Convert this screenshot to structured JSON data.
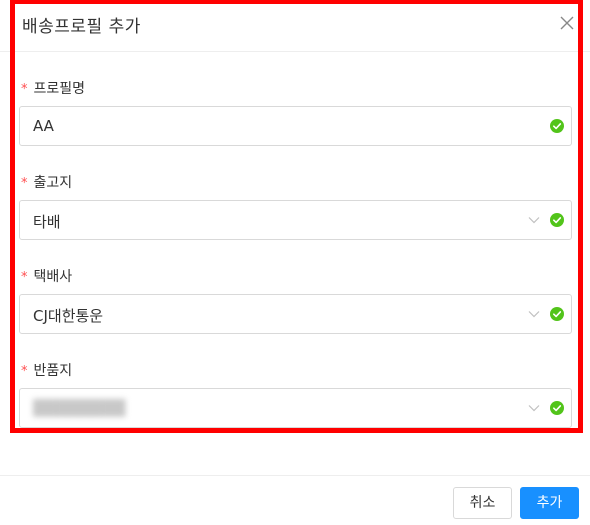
{
  "dialog": {
    "title": "배송프로필 추가"
  },
  "fields": [
    {
      "label": "프로필명",
      "required_mark": "*",
      "value": "AA",
      "type": "text",
      "valid": true
    },
    {
      "label": "출고지",
      "required_mark": "*",
      "value": "타배",
      "type": "select",
      "valid": true
    },
    {
      "label": "택배사",
      "required_mark": "*",
      "value": "CJ대한통운",
      "type": "select",
      "valid": true
    },
    {
      "label": "반품지",
      "required_mark": "*",
      "value": "",
      "type": "select",
      "valid": true
    }
  ],
  "footer": {
    "cancel_label": "취소",
    "add_label": "추가"
  },
  "colors": {
    "required": "#ff4d4f",
    "valid_check": "#52c41a",
    "primary": "#1890ff",
    "highlight": "#ff0000"
  },
  "icons": {
    "close": "close-icon",
    "chevron": "chevron-down-icon",
    "check": "check-circle-icon"
  }
}
